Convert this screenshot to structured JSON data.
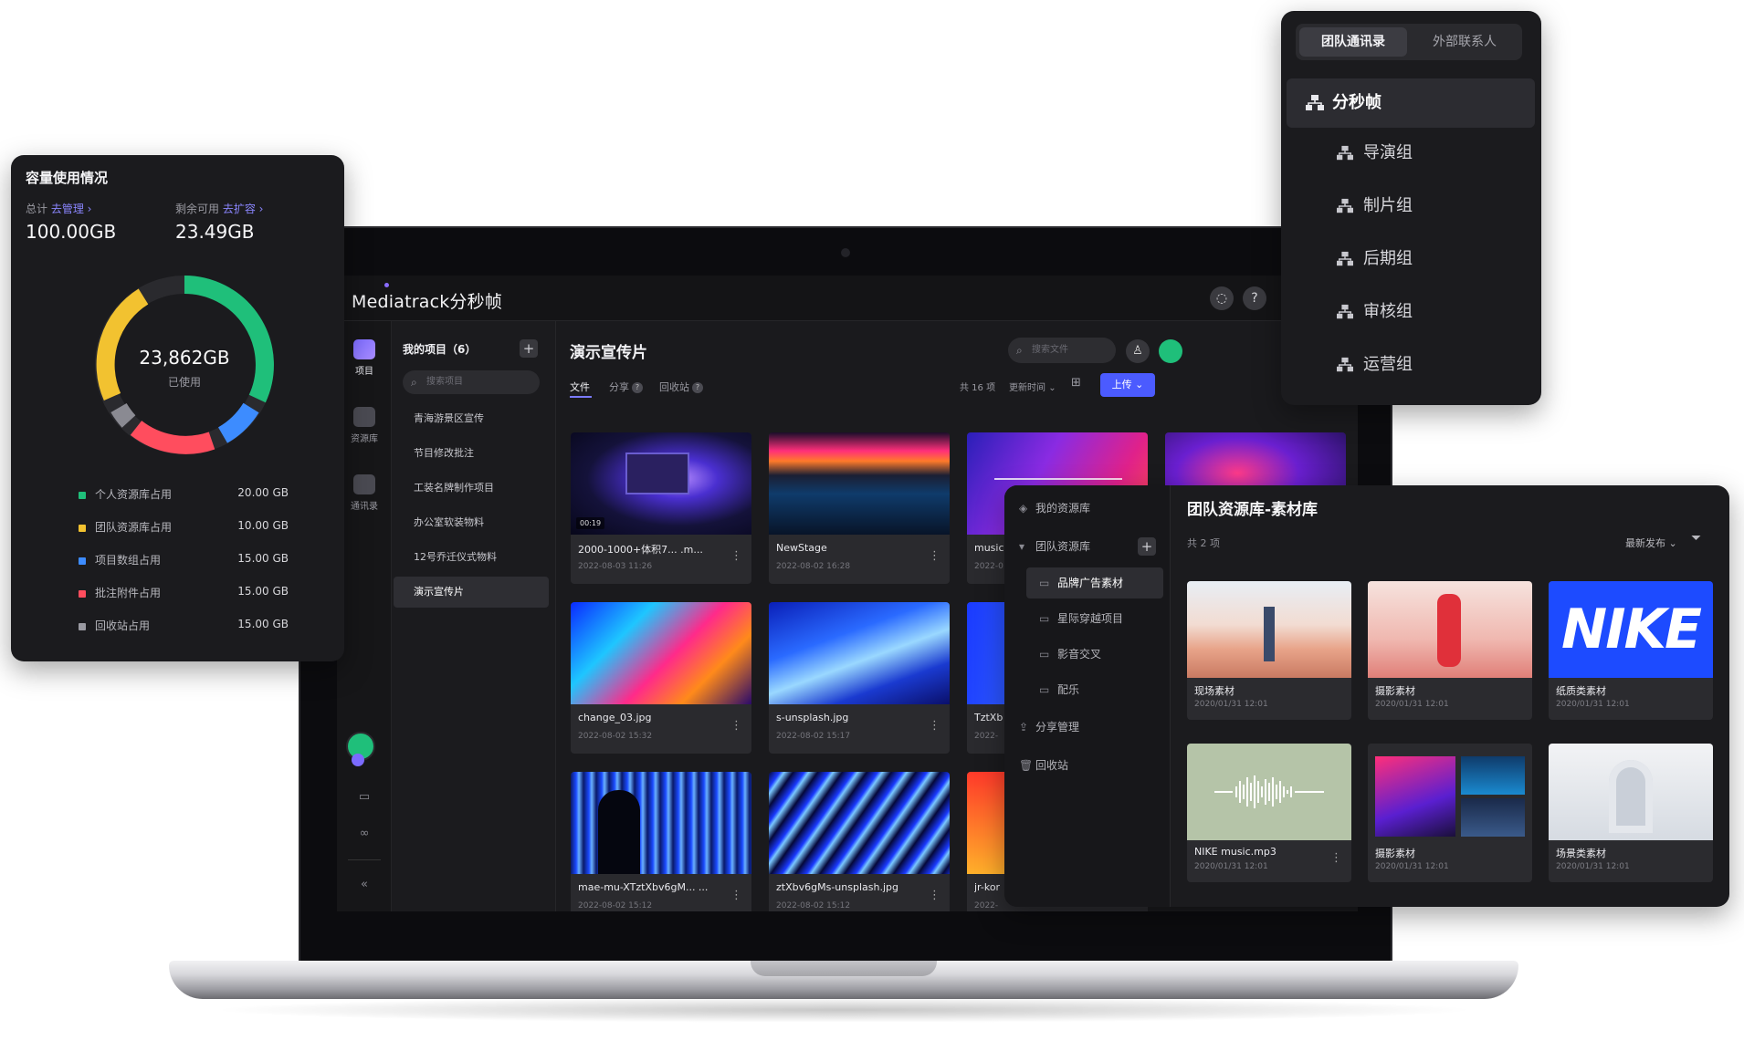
{
  "app": {
    "brand": "Mediatrack分秒帧",
    "topbar_icons": [
      "eye-off-icon",
      "help-icon"
    ]
  },
  "rail": {
    "items": [
      {
        "label": "项目",
        "icon": "grid-icon"
      },
      {
        "label": "资源库",
        "icon": "box-icon"
      },
      {
        "label": "通讯录",
        "icon": "contacts-icon"
      }
    ]
  },
  "projects": {
    "title": "我的项目（6）",
    "search_placeholder": "搜索项目",
    "items": [
      "青海游景区宣传",
      "节目修改批注",
      "工装名牌制作项目",
      "办公室软装物料",
      "12号乔迁仪式物料",
      "演示宣传片"
    ],
    "selected_index": 5
  },
  "main": {
    "title": "演示宣传片",
    "search_placeholder": "搜索文件",
    "tabs": [
      {
        "label": "文件"
      },
      {
        "label": "分享"
      },
      {
        "label": "回收站"
      }
    ],
    "count": "共 16 项",
    "sort": "更新时间",
    "upload_label": "上传",
    "files": [
      {
        "name": "2000-1000+体积7... .m...",
        "date": "2022-08-03 11:26",
        "tag": "00:19"
      },
      {
        "name": "NewStage",
        "date": "2022-08-02 16:28"
      },
      {
        "name": "music",
        "date": "2022-0"
      },
      {
        "name": "",
        "date": ""
      },
      {
        "name": "change_03.jpg",
        "date": "2022-08-02 15:32"
      },
      {
        "name": "s-unsplash.jpg",
        "date": "2022-08-02 15:17"
      },
      {
        "name": "TztXb",
        "date": "2022-"
      },
      {
        "name": "mae-mu-XTztXbv6gM... ...",
        "date": "2022-08-02 15:12"
      },
      {
        "name": "ztXbv6gMs-unsplash.jpg",
        "date": "2022-08-02 15:12"
      },
      {
        "name": "jr-kor",
        "date": "2022-"
      }
    ]
  },
  "capacity": {
    "title": "容量使用情况",
    "total_label": "总计",
    "manage_link": "去管理 ›",
    "remaining_label": "剩余可用",
    "expand_link": "去扩容 ›",
    "total_value": "100.00GB",
    "remaining_value": "23.49GB",
    "used_value": "23,862GB",
    "used_label": "已使用",
    "legend": [
      {
        "label": "个人资源库占用",
        "value": "20.00 GB",
        "color": "#1fbf7a"
      },
      {
        "label": "团队资源库占用",
        "value": "10.00 GB",
        "color": "#f2c230"
      },
      {
        "label": "项目数组占用",
        "value": "15.00 GB",
        "color": "#3d8cff"
      },
      {
        "label": "批注附件占用",
        "value": "15.00 GB",
        "color": "#ff4d5e"
      },
      {
        "label": "回收站占用",
        "value": "15.00 GB",
        "color": "#9a9aa2"
      }
    ]
  },
  "org": {
    "tabs": [
      "团队通讯录",
      "外部联系人"
    ],
    "root": "分秒帧",
    "groups": [
      "导演组",
      "制片组",
      "后期组",
      "审核组",
      "运营组"
    ]
  },
  "library": {
    "title": "团队资源库-素材库",
    "count": "共 2 项",
    "sort": "最新发布",
    "nav": [
      {
        "label": "我的资源库",
        "icon": "cube-icon",
        "sub": false
      },
      {
        "label": "团队资源库",
        "icon": "caret-down-icon",
        "sub": false
      },
      {
        "label": "品牌广告素材",
        "icon": "folder-icon",
        "sub": true,
        "selected": true
      },
      {
        "label": "星际穿越项目",
        "icon": "folder-icon",
        "sub": true
      },
      {
        "label": "影音交叉",
        "icon": "folder-icon",
        "sub": true
      },
      {
        "label": "配乐",
        "icon": "folder-icon",
        "sub": true
      },
      {
        "label": "分享管理",
        "icon": "share-icon",
        "sub": false
      },
      {
        "label": "回收站",
        "icon": "trash-icon",
        "sub": false
      }
    ],
    "cards": [
      {
        "name": "现场素材",
        "date": "2020/01/31 12:01"
      },
      {
        "name": "摄影素材",
        "date": "2020/01/31 12:01"
      },
      {
        "name": "纸质类素材",
        "date": "2020/01/31 12:01"
      },
      {
        "name": "NIKE music.mp3",
        "date": "2020/01/31 12:01"
      },
      {
        "name": "摄影素材",
        "date": "2020/01/31 12:01"
      },
      {
        "name": "场景类素材",
        "date": "2020/01/31 12:01"
      }
    ]
  }
}
